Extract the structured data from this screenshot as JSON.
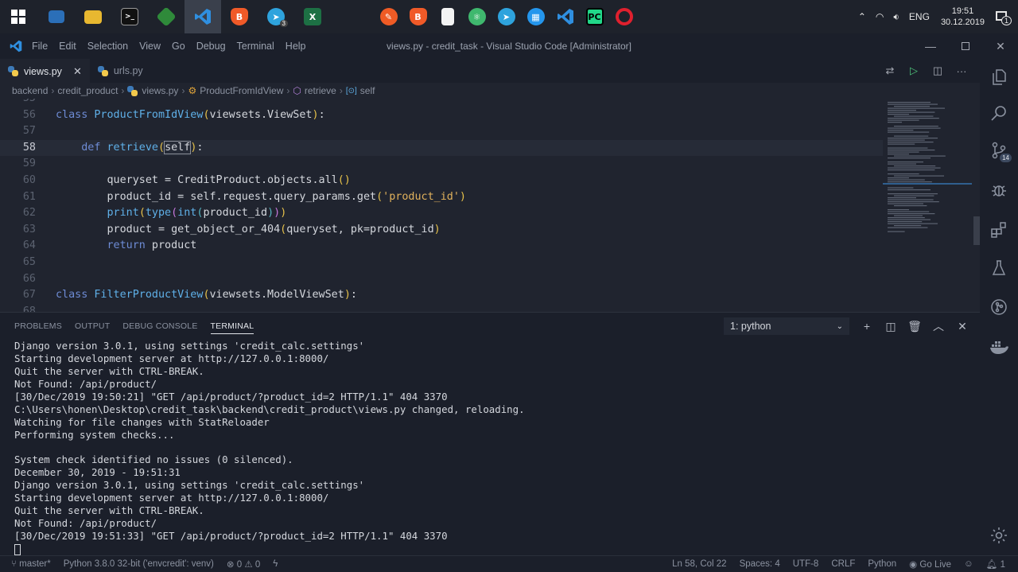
{
  "taskbar": {
    "pinned": [
      "start",
      "pc",
      "explorer",
      "cmd",
      "vim",
      "vscode",
      "brave",
      "telegram",
      "excel"
    ],
    "telegram_badge": "3",
    "tray_lang": "ENG",
    "clock_time": "19:51",
    "clock_date": "30.12.2019",
    "notification_count": "1"
  },
  "titlebar": {
    "menu": [
      "File",
      "Edit",
      "Selection",
      "View",
      "Go",
      "Debug",
      "Terminal",
      "Help"
    ],
    "title": "views.py - credit_task - Visual Studio Code [Administrator]"
  },
  "tabs": [
    {
      "label": "views.py",
      "active": true
    },
    {
      "label": "urls.py",
      "active": false
    }
  ],
  "breadcrumb": [
    "backend",
    "credit_product",
    "views.py",
    "ProductFromIdView",
    "retrieve",
    "self"
  ],
  "editor": {
    "current_line": "58",
    "lines": [
      {
        "n": "55",
        "text": ""
      },
      {
        "n": "56",
        "text": "class ProductFromIdView(viewsets.ViewSet):"
      },
      {
        "n": "57",
        "text": ""
      },
      {
        "n": "58",
        "text": "    def retrieve(self):"
      },
      {
        "n": "59",
        "text": ""
      },
      {
        "n": "60",
        "text": "        queryset = CreditProduct.objects.all()"
      },
      {
        "n": "61",
        "text": "        product_id = self.request.query_params.get('product_id')"
      },
      {
        "n": "62",
        "text": "        print(type(int(product_id)))"
      },
      {
        "n": "63",
        "text": "        product = get_object_or_404(queryset, pk=product_id)"
      },
      {
        "n": "64",
        "text": "        return product"
      },
      {
        "n": "65",
        "text": ""
      },
      {
        "n": "66",
        "text": ""
      },
      {
        "n": "67",
        "text": "class FilterProductView(viewsets.ModelViewSet):"
      },
      {
        "n": "68",
        "text": ""
      }
    ]
  },
  "panel": {
    "tabs": [
      "PROBLEMS",
      "OUTPUT",
      "DEBUG CONSOLE",
      "TERMINAL"
    ],
    "active_tab": "TERMINAL",
    "terminal_select": "1: python",
    "terminal_lines": [
      "Django version 3.0.1, using settings 'credit_calc.settings'",
      "Starting development server at http://127.0.0.1:8000/",
      "Quit the server with CTRL-BREAK.",
      "Not Found: /api/product/",
      "[30/Dec/2019 19:50:21] \"GET /api/product/?product_id=2 HTTP/1.1\" 404 3370",
      "C:\\Users\\honen\\Desktop\\credit_task\\backend\\credit_product\\views.py changed, reloading.",
      "Watching for file changes with StatReloader",
      "Performing system checks...",
      "",
      "System check identified no issues (0 silenced).",
      "December 30, 2019 - 19:51:31",
      "Django version 3.0.1, using settings 'credit_calc.settings'",
      "Starting development server at http://127.0.0.1:8000/",
      "Quit the server with CTRL-BREAK.",
      "Not Found: /api/product/",
      "[30/Dec/2019 19:51:33] \"GET /api/product/?product_id=2 HTTP/1.1\" 404 3370"
    ]
  },
  "activity": {
    "scm_badge": "14"
  },
  "status": {
    "branch": "master*",
    "interpreter": "Python 3.8.0 32-bit ('envcredit': venv)",
    "errors": "0",
    "warnings": "0",
    "position": "Ln 58, Col 22",
    "spaces": "Spaces: 4",
    "encoding": "UTF-8",
    "eol": "CRLF",
    "language": "Python",
    "golive": "Go Live",
    "notifications": "1"
  },
  "colors": {
    "accent_vscode": "#2f8fe0",
    "background": "#20242f",
    "keyword": "#6e8cd6",
    "string": "#e0b15c"
  }
}
